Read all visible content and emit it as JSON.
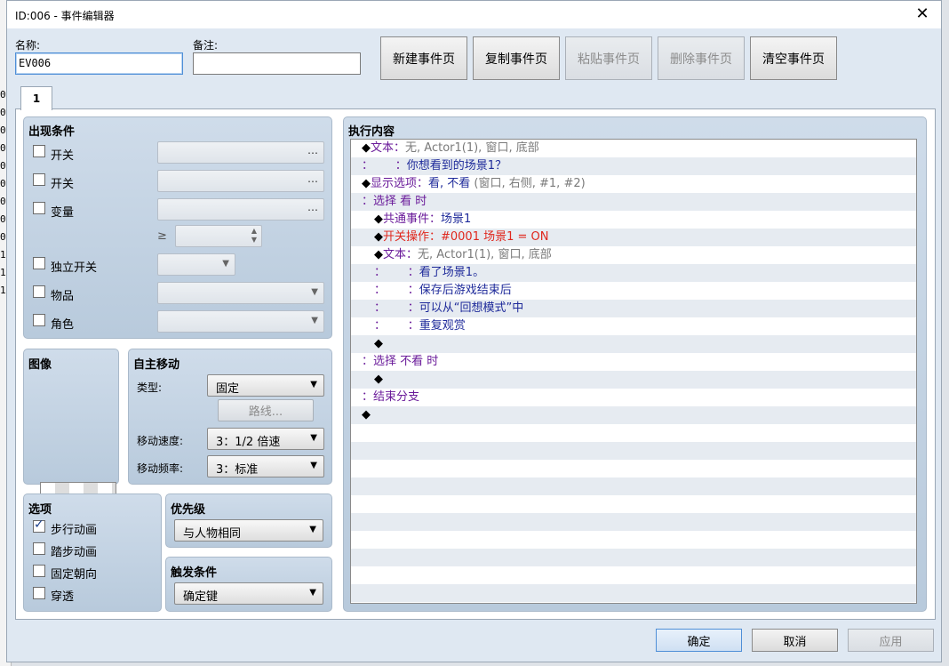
{
  "window": {
    "title": "ID:006 - 事件编辑器"
  },
  "background_numbers": [
    "0",
    "0",
    "0",
    "0",
    "0",
    "0",
    "0",
    "0",
    "0",
    "1",
    "1",
    "1"
  ],
  "fields": {
    "name_label": "名称:",
    "name_value": "EV006",
    "note_label": "备注:",
    "note_value": ""
  },
  "page_buttons": [
    "新建事件页",
    "复制事件页",
    "粘贴事件页",
    "删除事件页",
    "清空事件页"
  ],
  "tab_label": "1",
  "conditions": {
    "header": "出现条件",
    "items": [
      "开关",
      "开关",
      "变量",
      "独立开关",
      "物品",
      "角色"
    ],
    "ge_symbol": "≥",
    "dots": "…"
  },
  "image": {
    "header": "图像"
  },
  "autonomous": {
    "header": "自主移动",
    "type_label": "类型:",
    "type_value": "固定",
    "route_button": "路线...",
    "speed_label": "移动速度:",
    "speed_value": "3：1/2 倍速",
    "freq_label": "移动频率:",
    "freq_value": "3：标准"
  },
  "options": {
    "header": "选项",
    "items": [
      {
        "label": "步行动画",
        "checked": true
      },
      {
        "label": "踏步动画",
        "checked": false
      },
      {
        "label": "固定朝向",
        "checked": false
      },
      {
        "label": "穿透",
        "checked": false
      }
    ]
  },
  "priority": {
    "header": "优先级",
    "value": "与人物相同"
  },
  "trigger": {
    "header": "触发条件",
    "value": "确定键"
  },
  "contents": {
    "header": "执行内容",
    "lines": [
      {
        "indent": 0,
        "parts": [
          [
            "◆",
            ""
          ],
          [
            "文本：",
            "cmd"
          ],
          [
            "无, Actor1(1), 窗口, 底部",
            "arg"
          ]
        ]
      },
      {
        "indent": 0,
        "parts": [
          [
            "：      ：",
            "cmd"
          ],
          [
            "你想看到的场景1？",
            "txt"
          ]
        ]
      },
      {
        "indent": 0,
        "parts": [
          [
            "◆",
            ""
          ],
          [
            "显示选项：",
            "cmd"
          ],
          [
            "看, 不看",
            "blue"
          ],
          [
            " (窗口, 右侧, #1, #2)",
            "arg"
          ]
        ]
      },
      {
        "indent": 0,
        "parts": [
          [
            "：",
            "cmd"
          ],
          [
            "选择 看 时",
            "cmd"
          ]
        ]
      },
      {
        "indent": 1,
        "parts": [
          [
            "◆",
            ""
          ],
          [
            "共通事件：",
            "cmd"
          ],
          [
            "场景1",
            "blue"
          ]
        ]
      },
      {
        "indent": 1,
        "parts": [
          [
            "◆",
            ""
          ],
          [
            "开关操作：#0001 场景1 = ON",
            "red"
          ]
        ]
      },
      {
        "indent": 1,
        "parts": [
          [
            "◆",
            ""
          ],
          [
            "文本：",
            "cmd"
          ],
          [
            "无, Actor1(1), 窗口, 底部",
            "arg"
          ]
        ]
      },
      {
        "indent": 1,
        "parts": [
          [
            "：      ：",
            "cmd"
          ],
          [
            "看了场景1。",
            "txt"
          ]
        ]
      },
      {
        "indent": 1,
        "parts": [
          [
            "：      ：",
            "cmd"
          ],
          [
            "保存后游戏结束后",
            "txt"
          ]
        ]
      },
      {
        "indent": 1,
        "parts": [
          [
            "：      ：",
            "cmd"
          ],
          [
            "可以从“回想模式”中",
            "txt"
          ]
        ]
      },
      {
        "indent": 1,
        "parts": [
          [
            "：      ：",
            "cmd"
          ],
          [
            "重复观赏",
            "txt"
          ]
        ]
      },
      {
        "indent": 1,
        "parts": [
          [
            "◆",
            ""
          ]
        ]
      },
      {
        "indent": 0,
        "parts": [
          [
            "：",
            "cmd"
          ],
          [
            "选择 不看 时",
            "cmd"
          ]
        ]
      },
      {
        "indent": 1,
        "parts": [
          [
            "◆",
            ""
          ]
        ]
      },
      {
        "indent": 0,
        "parts": [
          [
            "：",
            "cmd"
          ],
          [
            "结束分支",
            "cmd"
          ]
        ]
      },
      {
        "indent": 0,
        "parts": [
          [
            "◆",
            ""
          ]
        ]
      }
    ]
  },
  "dialog_buttons": {
    "ok": "确定",
    "cancel": "取消",
    "apply": "应用"
  }
}
